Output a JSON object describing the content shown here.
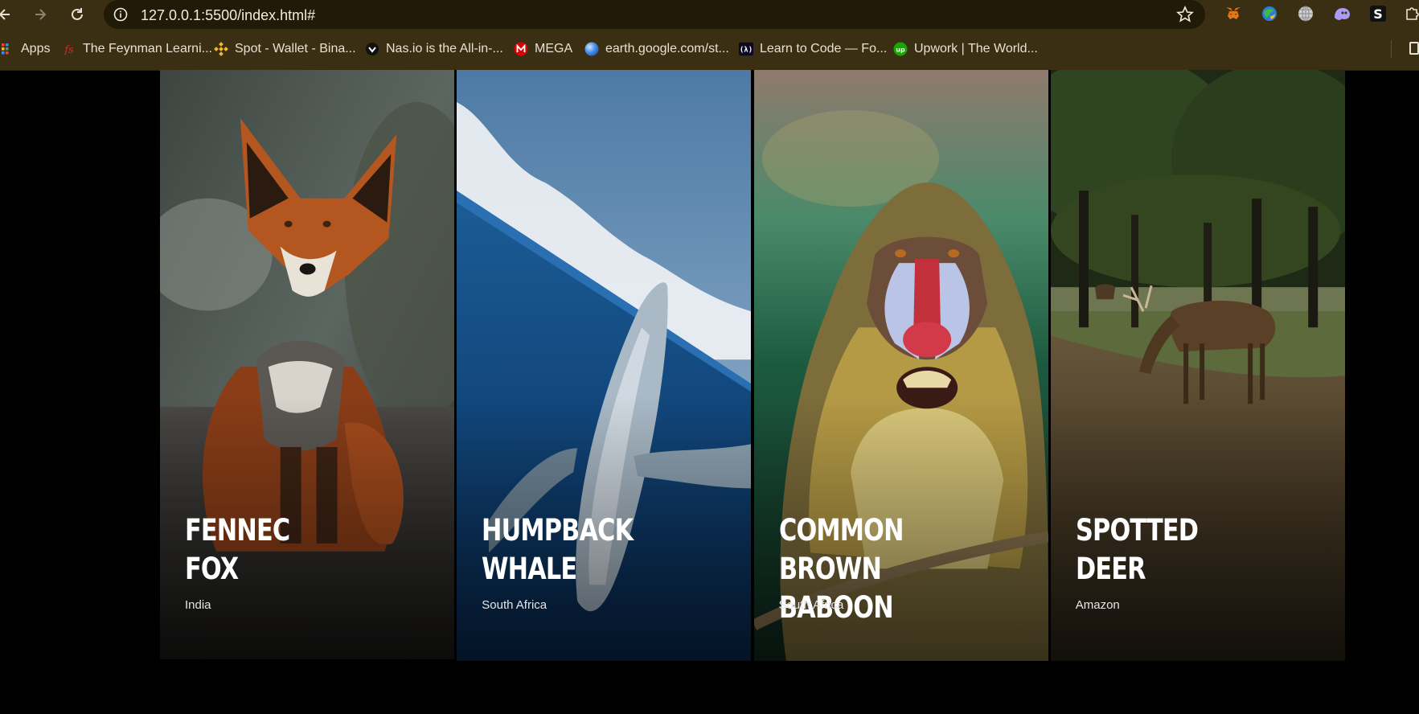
{
  "browser": {
    "url": "127.0.0.1:5500/index.html#",
    "bookmarks": [
      {
        "label": "Apps",
        "icon": "apps-grid-icon"
      },
      {
        "label": "The Feynman Learni...",
        "icon": "fs-logo-icon"
      },
      {
        "label": "Spot - Wallet - Bina...",
        "icon": "binance-icon"
      },
      {
        "label": "Nas.io is the All-in-...",
        "icon": "nasio-icon"
      },
      {
        "label": "MEGA",
        "icon": "mega-icon"
      },
      {
        "label": "earth.google.com/st...",
        "icon": "google-earth-icon"
      },
      {
        "label": "Learn to Code — Fo...",
        "icon": "freecodecamp-icon"
      },
      {
        "label": "Upwork | The World...",
        "icon": "upwork-icon"
      }
    ],
    "extensions": [
      "metamask-icon",
      "extension-globe-color-icon",
      "globe-icon",
      "ghost-extension-icon",
      "s-extension-icon",
      "extensions-puzzle-icon"
    ]
  },
  "cards": [
    {
      "title_line1": "FENNEC",
      "title_line2": "FOX",
      "location": "India",
      "photo": "fox-photo"
    },
    {
      "title_line1": "HUMPBACK",
      "title_line2": "WHALE",
      "location": "South Africa",
      "photo": "whale-photo"
    },
    {
      "title_line1": "COMMON BROWN",
      "title_line2": "BABOON",
      "location": "South Africa",
      "photo": "baboon-photo"
    },
    {
      "title_line1": "SPOTTED",
      "title_line2": "DEER",
      "location": "Amazon",
      "photo": "deer-photo"
    }
  ]
}
